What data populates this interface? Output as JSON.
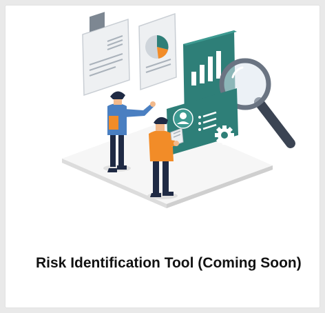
{
  "card": {
    "title": "Risk Identification Tool (Coming Soon)"
  },
  "illustration": {
    "icons": [
      "document-icon",
      "pie-chart-icon",
      "bar-chart-icon",
      "magnifying-glass-icon",
      "user-profile-icon",
      "gear-icon",
      "tablet-icon"
    ],
    "colors": {
      "teal": "#2e7f78",
      "teal_light": "#3d9a91",
      "orange": "#f28c28",
      "blue_shirt": "#4a7fc1",
      "navy": "#1f2a44",
      "panel_gray": "#eef0f2",
      "platform": "#f4f4f4"
    }
  }
}
